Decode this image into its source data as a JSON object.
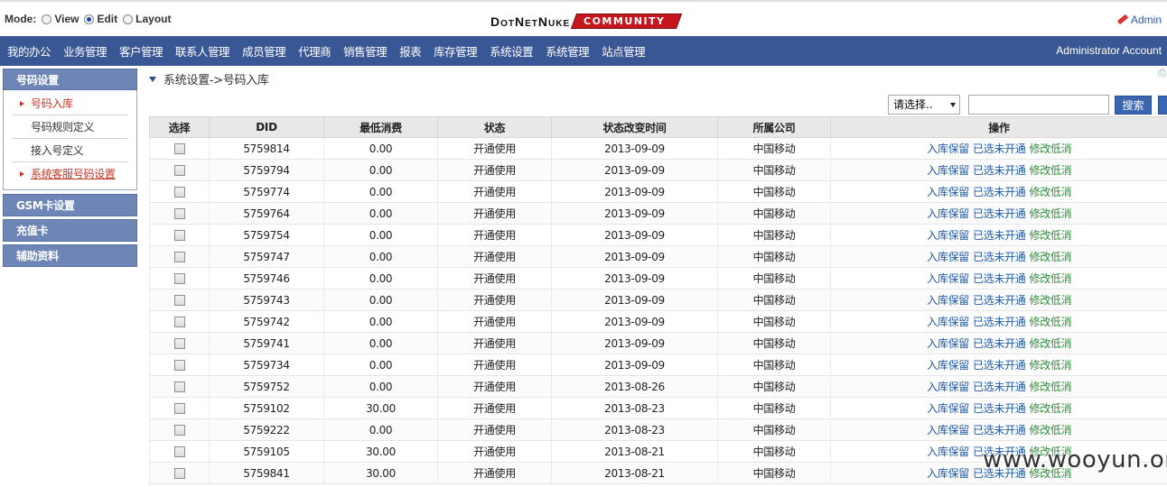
{
  "mode": {
    "label": "Mode:",
    "options": [
      {
        "label": "View",
        "selected": false
      },
      {
        "label": "Edit",
        "selected": true
      },
      {
        "label": "Layout",
        "selected": false
      }
    ]
  },
  "logo": {
    "main": "DotNetNuke",
    "tag": "COMMUNITY"
  },
  "admin_link": "Admin",
  "nav": {
    "items": [
      "我的办公",
      "业务管理",
      "客户管理",
      "联系人管理",
      "成员管理",
      "代理商",
      "销售管理",
      "报表",
      "库存管理",
      "系统设置",
      "系统管理",
      "站点管理"
    ],
    "account": "Administrator Account"
  },
  "sidebar": {
    "section1": {
      "title": "号码设置",
      "items": [
        {
          "label": "号码入库",
          "active": true
        },
        {
          "label": "号码规则定义",
          "active": false
        },
        {
          "label": "接入号定义",
          "active": false
        },
        {
          "label": "系统客服号码设置",
          "active": true
        }
      ]
    },
    "sections": [
      "GSM卡设置",
      "充值卡",
      "辅助资料"
    ]
  },
  "breadcrumb": "系统设置->号码入库",
  "search": {
    "select_value": "请选择..",
    "button": "搜索"
  },
  "table": {
    "headers": [
      "选择",
      "DID",
      "最低消费",
      "状态",
      "状态改变时间",
      "所属公司",
      "操作"
    ],
    "actions": [
      "入库保留",
      "已选未开通",
      "修改低消"
    ],
    "rows": [
      [
        "5759814",
        "0.00",
        "开通使用",
        "2013-09-09",
        "中国移动"
      ],
      [
        "5759794",
        "0.00",
        "开通使用",
        "2013-09-09",
        "中国移动"
      ],
      [
        "5759774",
        "0.00",
        "开通使用",
        "2013-09-09",
        "中国移动"
      ],
      [
        "5759764",
        "0.00",
        "开通使用",
        "2013-09-09",
        "中国移动"
      ],
      [
        "5759754",
        "0.00",
        "开通使用",
        "2013-09-09",
        "中国移动"
      ],
      [
        "5759747",
        "0.00",
        "开通使用",
        "2013-09-09",
        "中国移动"
      ],
      [
        "5759746",
        "0.00",
        "开通使用",
        "2013-09-09",
        "中国移动"
      ],
      [
        "5759743",
        "0.00",
        "开通使用",
        "2013-09-09",
        "中国移动"
      ],
      [
        "5759742",
        "0.00",
        "开通使用",
        "2013-09-09",
        "中国移动"
      ],
      [
        "5759741",
        "0.00",
        "开通使用",
        "2013-09-09",
        "中国移动"
      ],
      [
        "5759734",
        "0.00",
        "开通使用",
        "2013-09-09",
        "中国移动"
      ],
      [
        "5759752",
        "0.00",
        "开通使用",
        "2013-08-26",
        "中国移动"
      ],
      [
        "5759102",
        "30.00",
        "开通使用",
        "2013-08-23",
        "中国移动"
      ],
      [
        "5759222",
        "0.00",
        "开通使用",
        "2013-08-23",
        "中国移动"
      ],
      [
        "5759105",
        "30.00",
        "开通使用",
        "2013-08-21",
        "中国移动"
      ],
      [
        "5759841",
        "30.00",
        "开通使用",
        "2013-08-21",
        "中国移动"
      ]
    ]
  },
  "watermark": "www.wooyun.org",
  "colors": {
    "nav_bg": "#3a5795",
    "sidebar_head": "#6e86b7",
    "link_blue": "#1d5aa8",
    "link_green": "#2e8b3a",
    "active_red": "#c0392b"
  }
}
